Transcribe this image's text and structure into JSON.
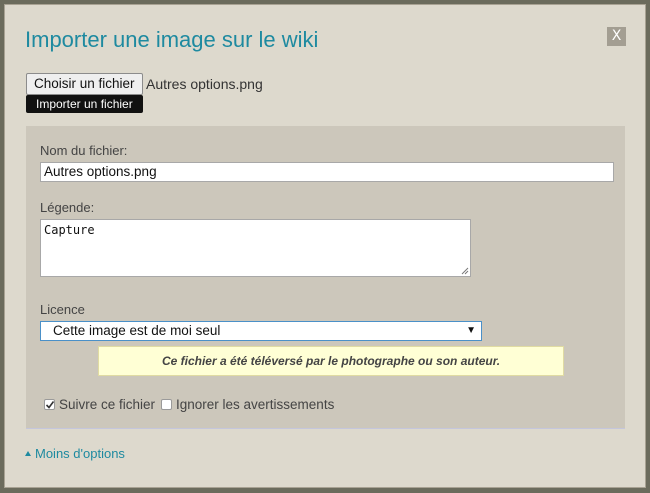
{
  "dialog": {
    "title": "Importer une image sur le wiki",
    "close_label": "X"
  },
  "file_picker": {
    "choose_label": "Choisir un fichier",
    "selected_file": "Autres options.png",
    "import_label": "Importer un fichier"
  },
  "form": {
    "filename_label": "Nom du fichier:",
    "filename_value": "Autres options.png",
    "caption_label": "Légende:",
    "caption_value": "Capture",
    "license_label": "Licence",
    "license_selected": "Cette image est de moi seul",
    "license_notice": "Ce fichier a été téléversé par le photographe ou son auteur.",
    "watch_label": "Suivre ce fichier",
    "watch_checked": true,
    "ignore_warnings_label": "Ignorer les avertissements",
    "ignore_warnings_checked": false
  },
  "footer": {
    "less_options_label": "Moins d'options"
  },
  "colors": {
    "accent": "#1e8aa0",
    "dialog_bg": "#ddd9cd",
    "panel_bg": "#ccc7bb",
    "notice_bg": "#ffffd5"
  }
}
